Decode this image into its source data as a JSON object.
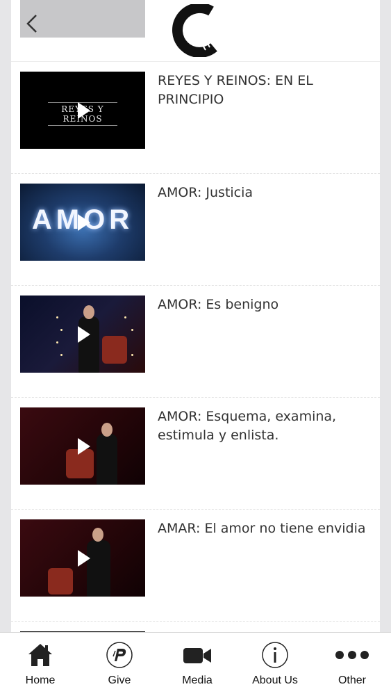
{
  "header": {
    "back_icon": "chevron-left-icon",
    "logo_icon": "church-logo-c-icon"
  },
  "media_items": [
    {
      "title": "REYES Y REINOS: EN EL PRINCIPIO",
      "thumb_text": "REYES Y REINOS"
    },
    {
      "title": "AMOR: Justicia",
      "thumb_text": "AMOR"
    },
    {
      "title": "AMOR: Es benigno"
    },
    {
      "title": "AMOR: Esquema, examina, estimula y enlista."
    },
    {
      "title": "AMAR: El amor no tiene envidia"
    }
  ],
  "tabs": [
    {
      "label": "Home",
      "icon": "home-icon"
    },
    {
      "label": "Give",
      "icon": "give-icon"
    },
    {
      "label": "Media",
      "icon": "video-camera-icon"
    },
    {
      "label": "About Us",
      "icon": "info-icon"
    },
    {
      "label": "Other",
      "icon": "more-icon"
    }
  ],
  "colors": {
    "background": "#e6e6e8",
    "back_button": "#c7c7c9",
    "title_text": "#333333"
  }
}
